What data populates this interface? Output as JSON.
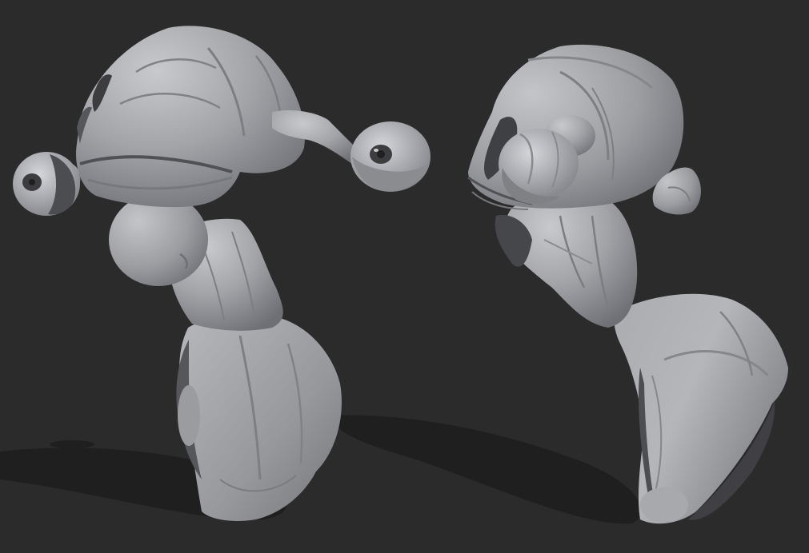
{
  "scene": {
    "background_color": "#2b2b2b",
    "shadow_color": "#1f1f1f",
    "clay_color": "#9ea0a4",
    "clay_highlight_color": "#c4c6ca",
    "clay_shade_color": "#6f7176",
    "cavity_color": "#3d3d40",
    "subjects": [
      {
        "name": "alien-bust-front-three-quarter",
        "features": [
          "eye-stalk-left",
          "eye-stalk-right",
          "throat-pouch",
          "torso"
        ]
      },
      {
        "name": "alien-bust-side-profile",
        "features": [
          "eye-stalk-front",
          "eye-stalk-back",
          "ribbed-neck",
          "torso"
        ]
      }
    ]
  }
}
